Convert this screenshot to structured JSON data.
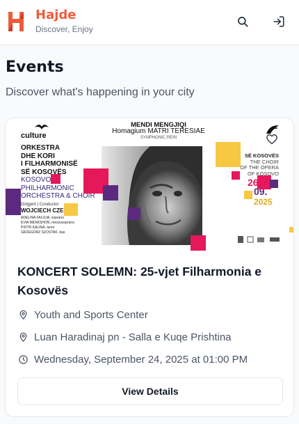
{
  "app": {
    "name": "Hajde",
    "tagline": "Discover, Enjoy",
    "brand_color": "#ef5b3b"
  },
  "header": {
    "icons": [
      "search-icon",
      "login-icon"
    ]
  },
  "page": {
    "title": "Events",
    "subtitle": "Discover what's happening in your city"
  },
  "event": {
    "title": "KONCERT SOLEMN: 25-vjet Filharmonia e Kosovës",
    "venue": "Youth and Sports Center",
    "address": "Luan Haradinaj pn - Salla e Kuqe Prishtina",
    "datetime": "Wednesday, September 24, 2025 at 01:00 PM",
    "details_label": "View Details",
    "favorite_icon": "heart-icon",
    "meta_icons": [
      "location-pin-icon",
      "location-pin-icon",
      "clock-icon"
    ]
  },
  "poster": {
    "culture": "culture",
    "orchestra_lines": [
      "ORKESTRA",
      "DHE KORI",
      "I FILHARMONISË",
      "SË KOSOVËS"
    ],
    "orchestra_en_lines": [
      "KOSOVO",
      "PHILHARMONIC",
      "ORCHESTRA & CHOIR"
    ],
    "dirigjent": "Dirigjent | Conductor",
    "conductor": "WOJCIECH CZEPIEL",
    "soloists": [
      "ADELINA FALOJA, soprano",
      "EVIA MENKSHON, mezzosoprano",
      "PIOTR KALINA, tenor",
      "GRZEGORZ SZOSTAK, bas"
    ],
    "composer": "MENDI MENGJIQI",
    "work": "Homagium MATRI TERESIAE",
    "work_sub": "SYMPHONIC REIN",
    "choir_lines": [
      "SË KOSOVËS",
      "THE CHOIR",
      "OF THE OPERA",
      "OF KOSOVO"
    ],
    "date_day": "26.",
    "date_month": "09.",
    "date_year": "2025",
    "colors": {
      "pink": "#e4185a",
      "purple": "#5b2a7e",
      "yellow": "#f7c843",
      "orange": "#e1a91d"
    }
  }
}
